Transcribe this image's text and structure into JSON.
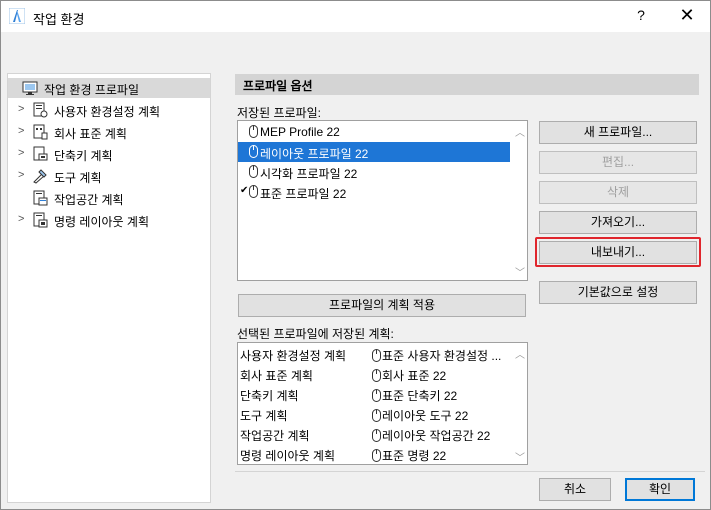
{
  "window": {
    "title": "작업 환경",
    "help": "?",
    "close": "✕"
  },
  "tree": {
    "items": [
      {
        "label": "작업 환경 프로파일",
        "icon": "monitor-icon",
        "selected": true,
        "expandable": false
      },
      {
        "label": "사용자 환경설정 계획",
        "icon": "user-prefs-icon",
        "selected": false,
        "expandable": true
      },
      {
        "label": "회사 표준 계획",
        "icon": "company-standards-icon",
        "selected": false,
        "expandable": true
      },
      {
        "label": "단축키 계획",
        "icon": "shortcuts-icon",
        "selected": false,
        "expandable": true
      },
      {
        "label": "도구 계획",
        "icon": "tools-icon",
        "selected": false,
        "expandable": true
      },
      {
        "label": "작업공간 계획",
        "icon": "workspace-icon",
        "selected": false,
        "expandable": false
      },
      {
        "label": "명령 레이아웃 계획",
        "icon": "command-layout-icon",
        "selected": false,
        "expandable": true
      }
    ]
  },
  "profile_options": {
    "header": "프로파일 옵션",
    "saved_label": "저장된 프로파일:",
    "profiles": [
      {
        "name": "MEP Profile 22",
        "selected": false,
        "default": false
      },
      {
        "name": "레이아웃 프로파일 22",
        "selected": true,
        "default": false
      },
      {
        "name": "시각화 프로파일 22",
        "selected": false,
        "default": false
      },
      {
        "name": "표준 프로파일 22",
        "selected": false,
        "default": true
      }
    ],
    "buttons": {
      "new": "새 프로파일...",
      "edit": "편집...",
      "delete": "삭제",
      "import": "가져오기...",
      "export": "내보내기...",
      "set_default": "기본값으로 설정"
    },
    "apply_button": "프로파일의 계획 적용",
    "plans_label": "선택된 프로파일에 저장된 계획:",
    "plans": [
      {
        "type": "사용자 환경설정 계획",
        "value": "표준 사용자 환경설정 ..."
      },
      {
        "type": "회사 표준 계획",
        "value": "회사 표준 22"
      },
      {
        "type": "단축키 계획",
        "value": "표준 단축키 22"
      },
      {
        "type": "도구 계획",
        "value": "레이아웃 도구 22"
      },
      {
        "type": "작업공간 계획",
        "value": "레이아웃 작업공간 22"
      },
      {
        "type": "명령 레이아웃 계획",
        "value": "표준 명령 22"
      }
    ]
  },
  "footer": {
    "cancel": "취소",
    "ok": "확인"
  },
  "colors": {
    "selection": "#1e76d6",
    "highlight_ring": "#e0262d",
    "header_bg": "#d4d4d4"
  }
}
